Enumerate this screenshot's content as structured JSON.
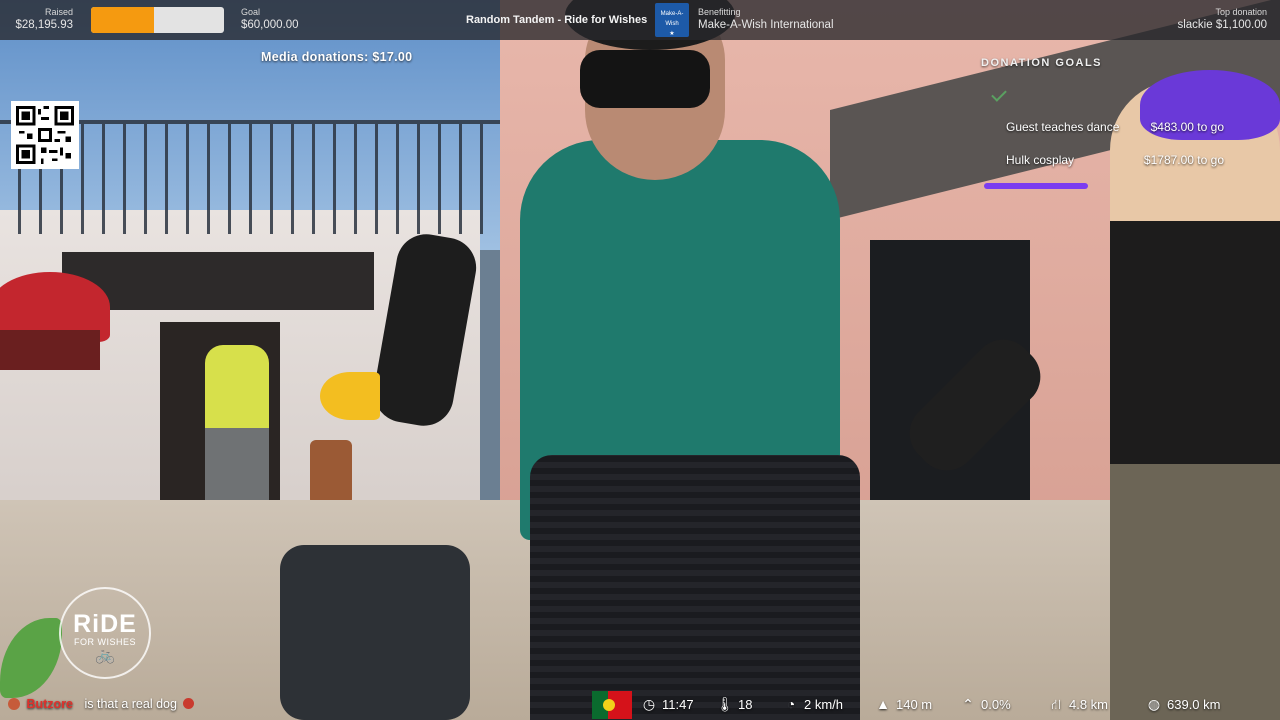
{
  "topbar": {
    "raised_label": "Raised",
    "raised_value": "$28,195.93",
    "progress_fraction": 0.47,
    "goal_label": "Goal",
    "goal_value": "$60,000.00",
    "stream_title": "Random Tandem - Ride for Wishes",
    "charity_logo_text": "Make-A-Wish",
    "benefitting_label": "Benefitting",
    "benefitting_value": "Make-A-Wish International",
    "top_donation_label": "Top donation",
    "top_donation_value": "slackie $1,100.00"
  },
  "overlay": {
    "media_donations": "Media donations: $17.00",
    "goals_title": "DONATION GOALS",
    "goals": [
      {
        "name": "Guest teaches dance",
        "amount": "$483.00 to go"
      },
      {
        "name": "Hulk cosplay",
        "amount": "$1787.00 to go"
      }
    ]
  },
  "logo": {
    "main": "RiDE",
    "sub": "FOR WISHES"
  },
  "chat": {
    "username": "Butzore",
    "message": "is that a real dog"
  },
  "stats": {
    "time": "11:47",
    "temperature": "18",
    "speed": "2 km/h",
    "altitude": "140 m",
    "grade": "0.0%",
    "distance_day": "4.8 km",
    "distance_total": "639.0 km"
  },
  "icons": {
    "clock": "clock-icon",
    "thermometer": "thermometer-icon",
    "speedometer": "speedometer-icon",
    "mountain": "mountain-icon",
    "grade": "grade-icon",
    "road": "road-icon",
    "globe": "globe-icon"
  },
  "colors": {
    "progress_fill": "#f59a10",
    "goal_bar": "#7b3cf0",
    "chat_username": "#e0302b"
  }
}
